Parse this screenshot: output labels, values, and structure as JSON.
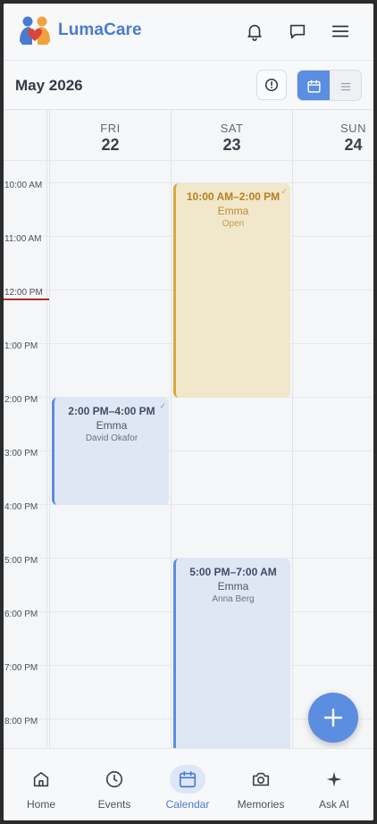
{
  "app": {
    "name": "LumaCare"
  },
  "month_bar": {
    "title": "May 2026"
  },
  "days": [
    {
      "name": "FRI",
      "num": "22"
    },
    {
      "name": "SAT",
      "num": "23"
    },
    {
      "name": "SUN",
      "num": "24"
    }
  ],
  "hours": [
    "10:00 AM",
    "11:00 AM",
    "12:00 PM",
    "1:00 PM",
    "2:00 PM",
    "3:00 PM",
    "4:00 PM",
    "5:00 PM",
    "6:00 PM",
    "7:00 PM",
    "8:00 PM"
  ],
  "events": [
    {
      "time": "10:00 AM–2:00 PM",
      "person": "Emma",
      "sub": "Open"
    },
    {
      "time": "2:00 PM–4:00 PM",
      "person": "Emma",
      "sub": "David Okafor"
    },
    {
      "time": "5:00 PM–7:00 AM",
      "person": "Emma",
      "sub": "Anna Berg"
    }
  ],
  "nav": [
    {
      "label": "Home",
      "icon": "home-icon"
    },
    {
      "label": "Events",
      "icon": "clock-icon"
    },
    {
      "label": "Calendar",
      "icon": "calendar-icon"
    },
    {
      "label": "Memories",
      "icon": "camera-icon"
    },
    {
      "label": "Ask AI",
      "icon": "sparkle-icon"
    }
  ],
  "colors": {
    "accent": "#5b8de0",
    "brand": "#4a7bd1",
    "pending": "#e0a63a",
    "now_line": "#b52a2a"
  }
}
